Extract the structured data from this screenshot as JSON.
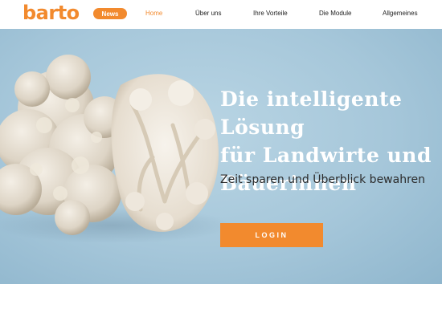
{
  "header": {
    "logo": "barto",
    "news_badge": "News",
    "nav": [
      {
        "label": "Home",
        "active": true
      },
      {
        "label": "Über uns",
        "active": false
      },
      {
        "label": "Ihre Vorteile",
        "active": false
      },
      {
        "label": "Die Module",
        "active": false
      },
      {
        "label": "Allgemeines",
        "active": false
      }
    ]
  },
  "hero": {
    "headline": "Die intelligente Lösung\nfür Landwirte und\nBäuerinnen",
    "subline": "Zeit sparen und Überblick bewahren",
    "login_label": "LOGIN",
    "image": "cauliflower-image"
  },
  "colors": {
    "accent": "#f28a2e",
    "hero_background": "#a6c7da",
    "headline_text": "#ffffff"
  }
}
